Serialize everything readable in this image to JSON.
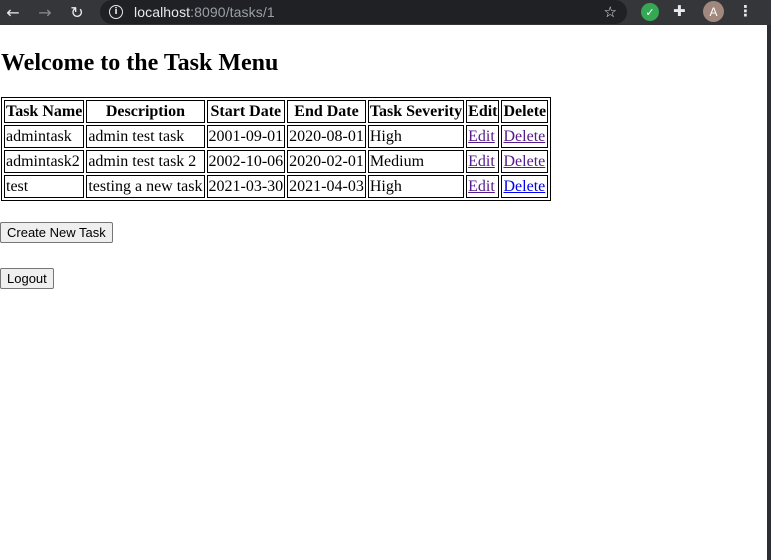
{
  "browser": {
    "url_host": "localhost",
    "url_rest": ":8090/tasks/1",
    "avatar_letter": "A"
  },
  "page": {
    "title": "Welcome to the Task Menu",
    "table": {
      "headers": [
        "Task Name",
        "Description",
        "Start Date",
        "End Date",
        "Task Severity",
        "Edit",
        "Delete"
      ],
      "rows": [
        {
          "name": "admintask",
          "description": "admin test task",
          "start": "2001-09-01",
          "end": "2020-08-01",
          "severity": "High",
          "edit": "Edit",
          "delete": "Delete"
        },
        {
          "name": "admintask2",
          "description": "admin test task 2",
          "start": "2002-10-06",
          "end": "2020-02-01",
          "severity": "Medium",
          "edit": "Edit",
          "delete": "Delete"
        },
        {
          "name": "test",
          "description": "testing a new task",
          "start": "2021-03-30",
          "end": "2021-04-03",
          "severity": "High",
          "edit": "Edit",
          "delete": "Delete"
        }
      ]
    },
    "create_button": "Create New Task",
    "logout_button": "Logout"
  },
  "colors": {
    "visited_link": "#551a8b",
    "link": "#0000ee",
    "chrome_bg": "#35363a"
  }
}
